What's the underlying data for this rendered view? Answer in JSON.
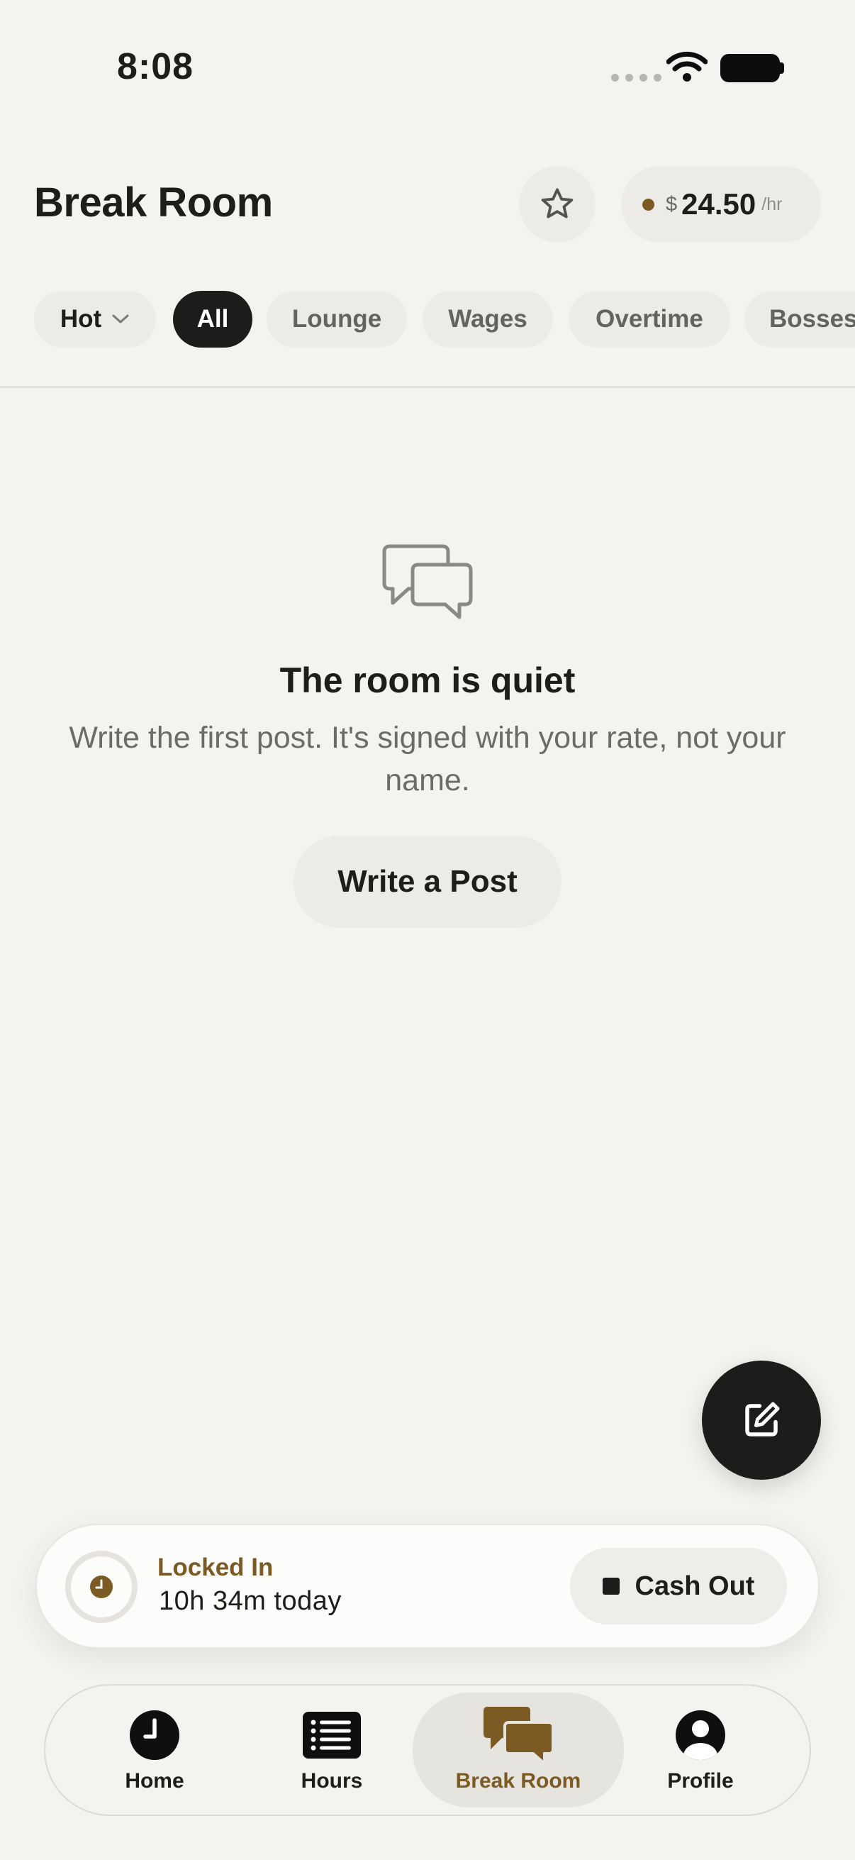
{
  "status_bar": {
    "time": "8:08"
  },
  "header": {
    "title": "Break Room",
    "favorite_icon": "star-outline-icon",
    "rate": {
      "currency": "$",
      "amount": "24.50",
      "unit": "/hr",
      "dot_color": "#7C5A24"
    }
  },
  "filters": {
    "sort_label": "Hot",
    "chips": [
      "All",
      "Lounge",
      "Wages",
      "Overtime",
      "Bosses"
    ],
    "active_chip": "All"
  },
  "empty_state": {
    "icon": "chat-bubbles-icon",
    "title": "The room is quiet",
    "body": "Write the first post. It's signed with your rate, not your name.",
    "button_label": "Write a Post"
  },
  "fab": {
    "icon": "compose-icon"
  },
  "shift_bar": {
    "status": "Locked In",
    "duration": "10h 34m today",
    "cash_out_label": "Cash Out"
  },
  "tab_bar": {
    "tabs": [
      {
        "label": "Home",
        "icon": "clock-icon"
      },
      {
        "label": "Hours",
        "icon": "list-icon"
      },
      {
        "label": "Break Room",
        "icon": "chat-bubbles-icon"
      },
      {
        "label": "Profile",
        "icon": "person-icon"
      }
    ],
    "active_tab": "Break Room"
  },
  "colors": {
    "background": "#F4F3EF",
    "accent_brown": "#7C5A24",
    "dark": "#1D1C1A",
    "muted_text": "#6D6B66"
  }
}
